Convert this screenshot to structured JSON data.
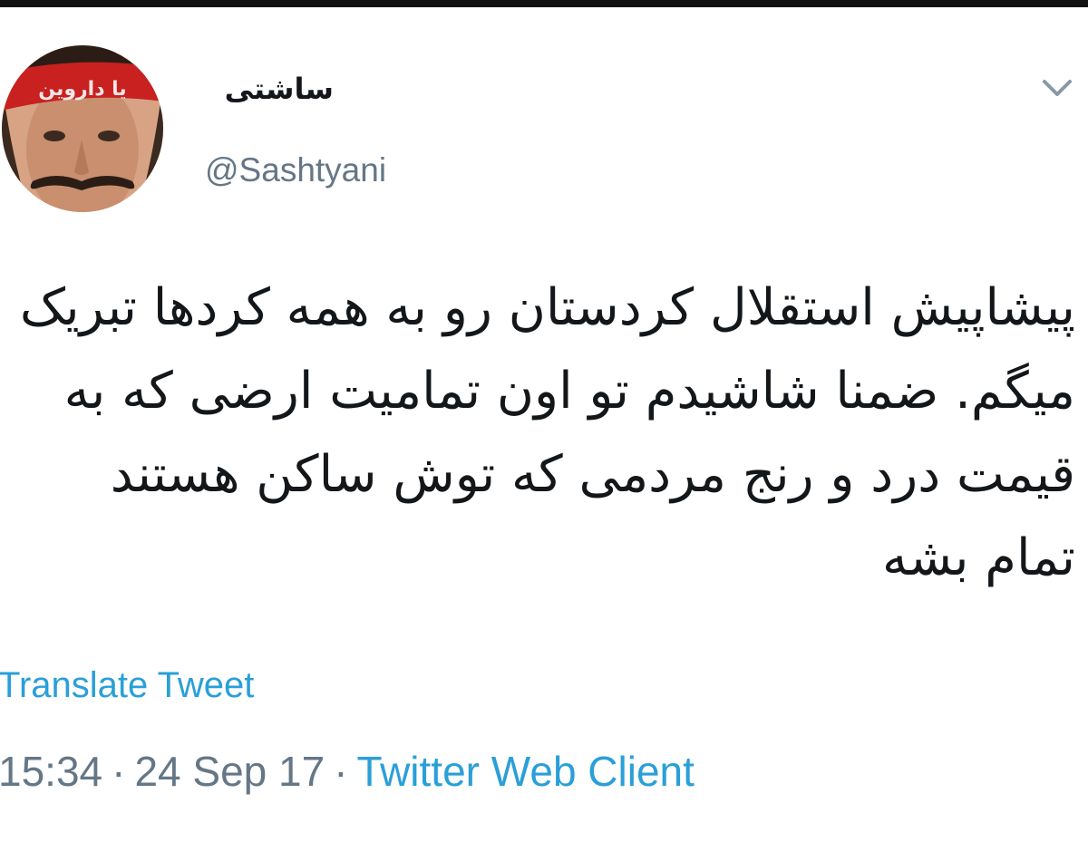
{
  "tweet": {
    "author": {
      "display_name": "ساشتی",
      "handle": "@Sashtyani",
      "avatar_headband_text": "یا داروین"
    },
    "text": "پیشاپیش استقلال کردستان رو به همه کردها تبریک میگم. ضمنا شاشیدم تو اون تمامیت ارضی که به قیمت درد و رنج مردمی که توش ساکن هستند تمام بشه",
    "translate_label": "Translate Tweet",
    "time": "15:34",
    "date": "24 Sep 17",
    "separator": "·",
    "source": "Twitter Web Client"
  },
  "icons": {
    "menu": "chevron-down-icon"
  },
  "colors": {
    "link": "#2a9fd8",
    "muted": "#657786",
    "text": "#14171a",
    "top_bar": "#111111",
    "headband": "#c8211f"
  }
}
